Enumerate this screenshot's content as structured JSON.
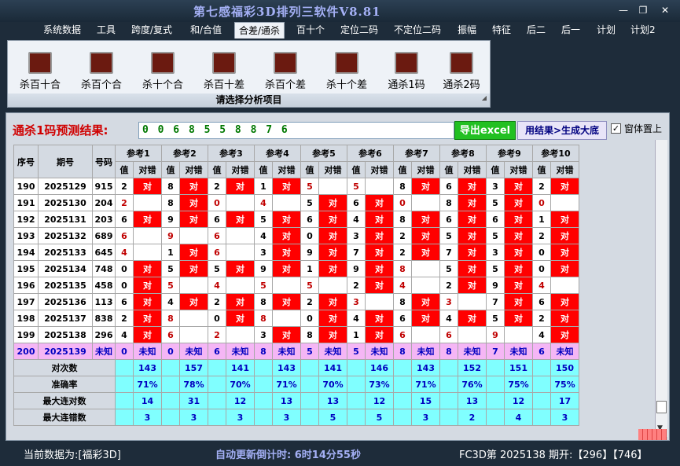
{
  "window": {
    "title": "第七感福彩3D排列三软件V8.81"
  },
  "menu": [
    {
      "label": "系统数据",
      "active": false
    },
    {
      "label": "工具",
      "active": false
    },
    {
      "label": "跨度/复式",
      "active": false
    },
    {
      "label": "和/合值",
      "active": false
    },
    {
      "label": "合差/通杀",
      "active": true
    },
    {
      "label": "百十个",
      "active": false
    },
    {
      "label": "定位二码",
      "active": false
    },
    {
      "label": "不定位二码",
      "active": false
    },
    {
      "label": "振幅",
      "active": false
    },
    {
      "label": "特征",
      "active": false
    },
    {
      "label": "后二",
      "active": false
    },
    {
      "label": "后一",
      "active": false
    },
    {
      "label": "计划",
      "active": false
    },
    {
      "label": "计划2",
      "active": false
    }
  ],
  "ribbon": {
    "buttons": [
      "杀百十合",
      "杀百个合",
      "杀十个合",
      "杀百十差",
      "杀百个差",
      "杀十个差",
      "通杀1码",
      "通杀2码"
    ],
    "caption": "请选择分析项目"
  },
  "result": {
    "label": "通杀1码预测结果:",
    "value": "0 0 6 8 5 5 8 8 7 6",
    "export_button": "导出excel",
    "generate_button": "用结果>生成大底",
    "pin_checkbox": "窗体置上",
    "pin_checked": true
  },
  "table": {
    "headers": {
      "seq": "序号",
      "period": "期号",
      "number": "号码",
      "value": "值",
      "check": "对错"
    },
    "refs": [
      "参考1",
      "参考2",
      "参考3",
      "参考4",
      "参考5",
      "参考6",
      "参考7",
      "参考8",
      "参考9",
      "参考10"
    ],
    "hit_text": "对",
    "rows": [
      {
        "seq": "190",
        "period": "2025129",
        "number": "915",
        "vals": [
          "2",
          "8",
          "2",
          "1",
          "5",
          "5",
          "8",
          "6",
          "3",
          "2"
        ],
        "hits": [
          1,
          1,
          1,
          1,
          0,
          0,
          1,
          1,
          1,
          1
        ]
      },
      {
        "seq": "191",
        "period": "2025130",
        "number": "204",
        "vals": [
          "2",
          "8",
          "0",
          "4",
          "5",
          "6",
          "0",
          "8",
          "5",
          "0"
        ],
        "hits": [
          0,
          1,
          0,
          0,
          1,
          1,
          0,
          1,
          1,
          0
        ]
      },
      {
        "seq": "192",
        "period": "2025131",
        "number": "203",
        "vals": [
          "6",
          "9",
          "6",
          "5",
          "6",
          "4",
          "8",
          "6",
          "6",
          "1"
        ],
        "hits": [
          1,
          1,
          1,
          1,
          1,
          1,
          1,
          1,
          1,
          1
        ]
      },
      {
        "seq": "193",
        "period": "2025132",
        "number": "689",
        "vals": [
          "6",
          "9",
          "6",
          "4",
          "0",
          "3",
          "2",
          "5",
          "5",
          "2"
        ],
        "hits": [
          0,
          0,
          0,
          1,
          1,
          1,
          1,
          1,
          1,
          1
        ]
      },
      {
        "seq": "194",
        "period": "2025133",
        "number": "645",
        "vals": [
          "4",
          "1",
          "6",
          "3",
          "9",
          "7",
          "2",
          "7",
          "3",
          "0"
        ],
        "hits": [
          0,
          1,
          0,
          1,
          1,
          1,
          1,
          1,
          1,
          1
        ]
      },
      {
        "seq": "195",
        "period": "2025134",
        "number": "748",
        "vals": [
          "0",
          "5",
          "5",
          "9",
          "1",
          "9",
          "8",
          "5",
          "5",
          "0"
        ],
        "hits": [
          1,
          1,
          1,
          1,
          1,
          1,
          0,
          1,
          1,
          1
        ]
      },
      {
        "seq": "196",
        "period": "2025135",
        "number": "458",
        "vals": [
          "0",
          "5",
          "4",
          "5",
          "5",
          "2",
          "4",
          "2",
          "9",
          "4"
        ],
        "hits": [
          1,
          0,
          0,
          0,
          0,
          1,
          0,
          1,
          1,
          0
        ]
      },
      {
        "seq": "197",
        "period": "2025136",
        "number": "113",
        "vals": [
          "6",
          "4",
          "2",
          "8",
          "2",
          "3",
          "8",
          "3",
          "7",
          "6"
        ],
        "hits": [
          1,
          1,
          1,
          1,
          1,
          0,
          1,
          0,
          1,
          1
        ]
      },
      {
        "seq": "198",
        "period": "2025137",
        "number": "838",
        "vals": [
          "2",
          "8",
          "0",
          "8",
          "0",
          "4",
          "6",
          "4",
          "5",
          "2"
        ],
        "hits": [
          1,
          0,
          1,
          0,
          1,
          1,
          1,
          1,
          1,
          1
        ]
      },
      {
        "seq": "199",
        "period": "2025138",
        "number": "296",
        "vals": [
          "4",
          "6",
          "2",
          "3",
          "8",
          "1",
          "6",
          "6",
          "9",
          "4"
        ],
        "hits": [
          1,
          0,
          0,
          1,
          1,
          1,
          0,
          0,
          0,
          1
        ]
      }
    ],
    "pred": {
      "seq": "200",
      "period": "2025139",
      "number": "未知",
      "vals": [
        "0",
        "0",
        "6",
        "8",
        "5",
        "5",
        "8",
        "8",
        "7",
        "6"
      ],
      "unknown": "未知"
    },
    "stats": [
      {
        "label": "对次数",
        "values": [
          "143",
          "157",
          "141",
          "143",
          "141",
          "146",
          "143",
          "152",
          "151",
          "150"
        ]
      },
      {
        "label": "准确率",
        "values": [
          "71%",
          "78%",
          "70%",
          "71%",
          "70%",
          "73%",
          "71%",
          "76%",
          "75%",
          "75%"
        ]
      },
      {
        "label": "最大连对数",
        "values": [
          "14",
          "31",
          "12",
          "13",
          "13",
          "12",
          "15",
          "13",
          "12",
          "17"
        ]
      },
      {
        "label": "最大连错数",
        "values": [
          "3",
          "3",
          "3",
          "3",
          "5",
          "5",
          "3",
          "2",
          "4",
          "3"
        ]
      }
    ]
  },
  "status": {
    "current": "当前数据为:[福彩3D]",
    "countdown": "自动更新倒计时: 6时14分55秒",
    "draw": "FC3D第 2025138 期开:【296】【746】"
  },
  "colors": {
    "hit": "#ff0000",
    "pred_row": "#f5b6f5",
    "stats_row": "#80ffff",
    "result_text": "#007800"
  }
}
